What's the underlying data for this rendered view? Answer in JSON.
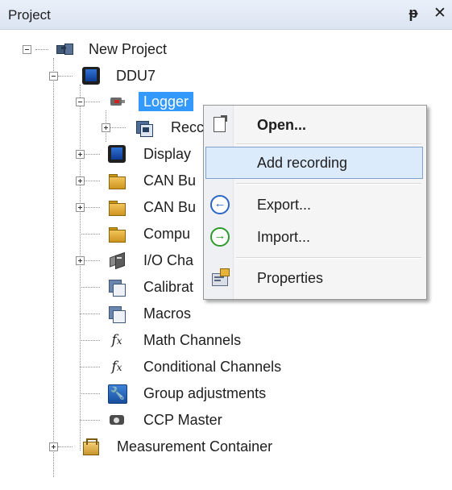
{
  "panel": {
    "title": "Project",
    "pin_glyph": "ᵽ",
    "close_glyph": "✕"
  },
  "tree": {
    "root": "New Project",
    "device": "DDU7",
    "logger": "Logger",
    "recordings": "Recc",
    "display": "Display",
    "can_bus_1": "CAN Bu",
    "can_bus_2": "CAN Bu",
    "computed": "Compu",
    "io_channels": "I/O Cha",
    "calibration": "Calibrat",
    "macros": "Macros",
    "math_channels": "Math Channels",
    "conditional_channels": "Conditional Channels",
    "group_adjustments": "Group adjustments",
    "ccp_master": "CCP Master",
    "measurement_container": "Measurement Container",
    "fx_glyph": "f",
    "fx_sub": "x",
    "wrench_glyph": "🔧"
  },
  "context_menu": {
    "open": "Open...",
    "add_recording": "Add recording",
    "export": "Export...",
    "import": "Import...",
    "properties": "Properties",
    "export_glyph": "←",
    "import_glyph": "→"
  },
  "colors": {
    "selection": "#3399ff",
    "menu_hover": "#dcebfc",
    "menu_hover_border": "#7da2ce"
  }
}
